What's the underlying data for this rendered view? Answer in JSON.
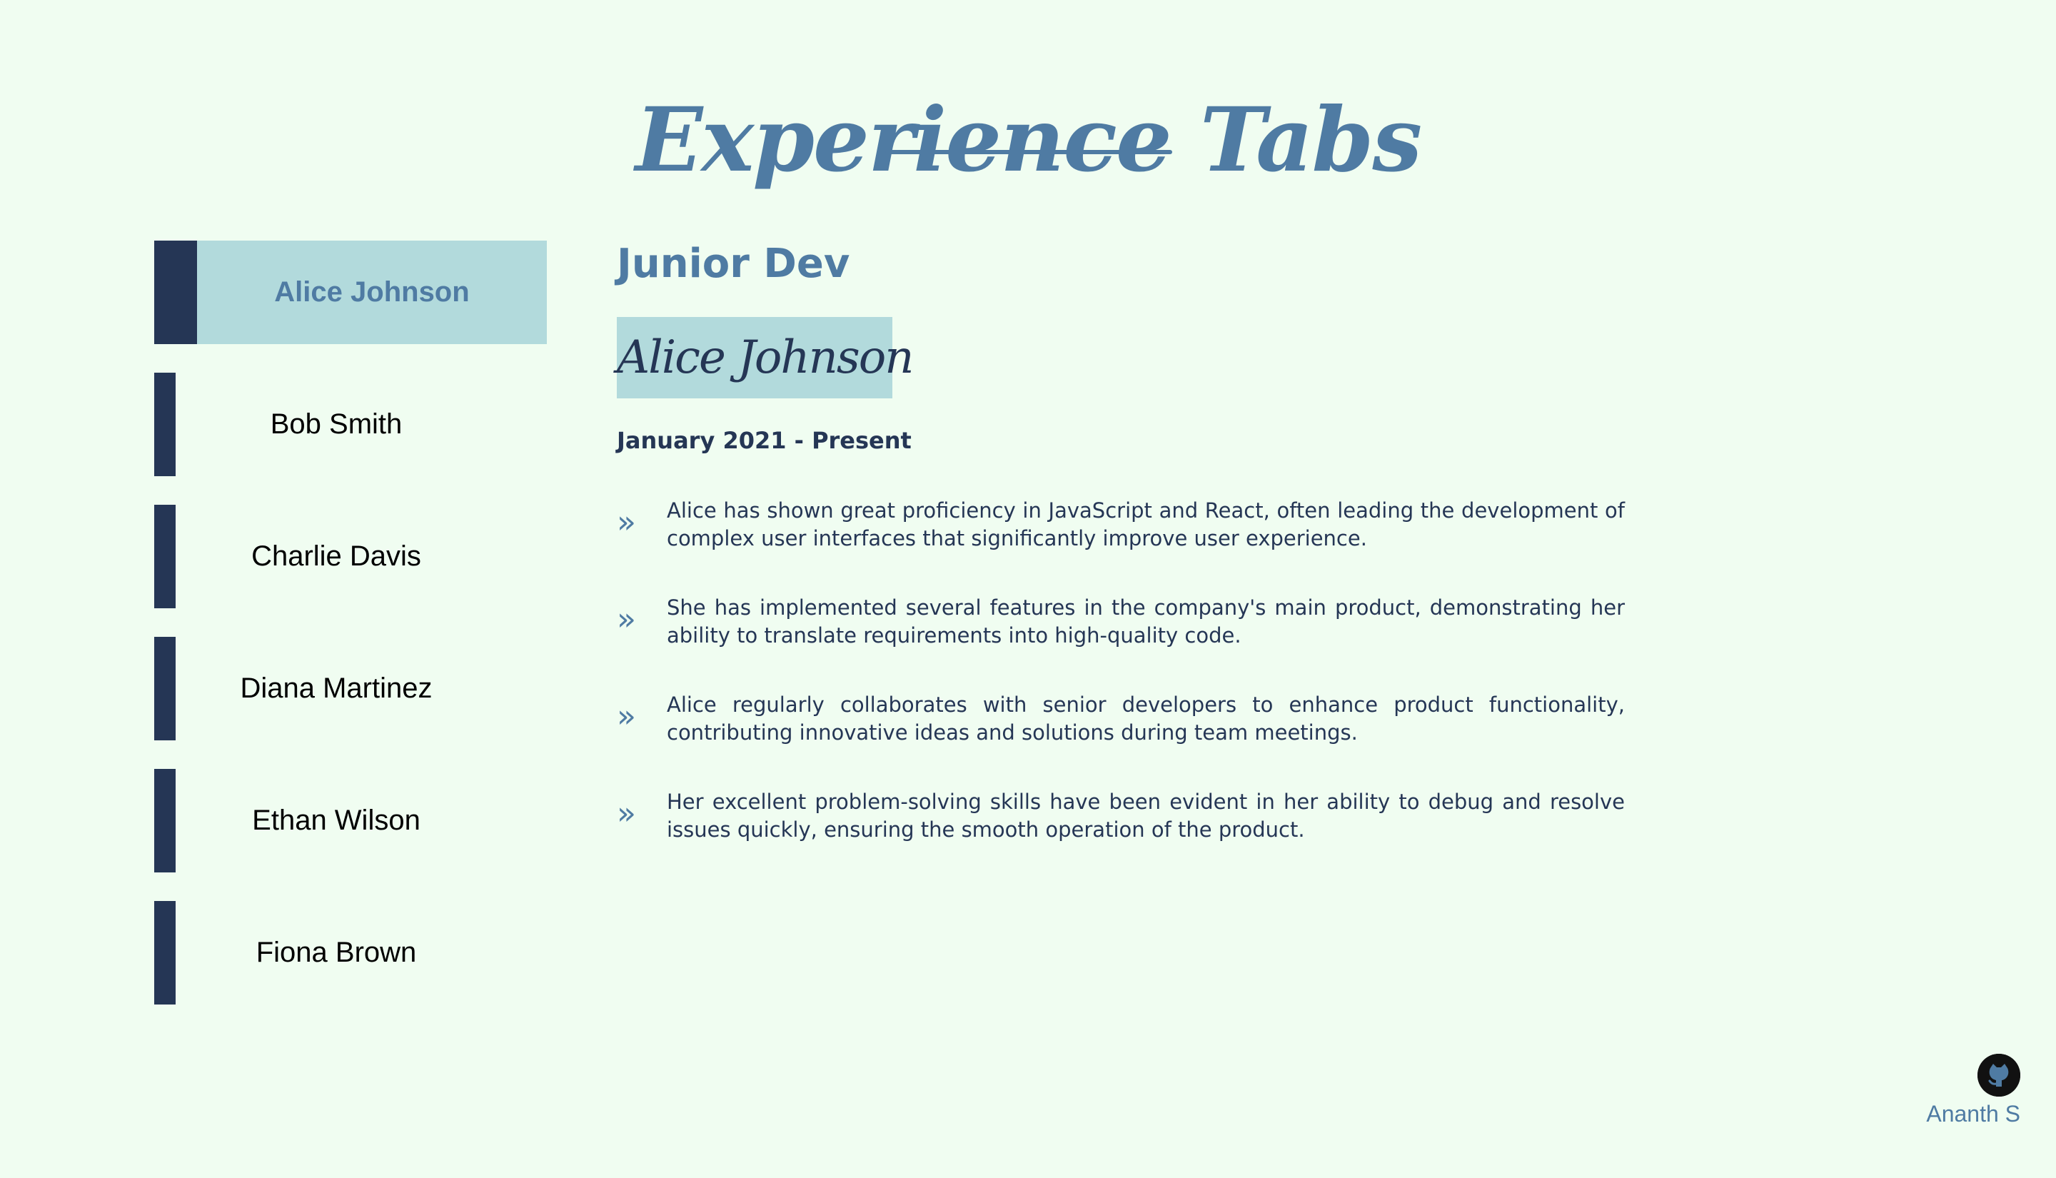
{
  "header": {
    "title": "Experience Tabs"
  },
  "tabs": [
    {
      "label": "Alice Johnson",
      "active": true
    },
    {
      "label": "Bob Smith",
      "active": false
    },
    {
      "label": "Charlie Davis",
      "active": false
    },
    {
      "label": "Diana Martinez",
      "active": false
    },
    {
      "label": "Ethan Wilson",
      "active": false
    },
    {
      "label": "Fiona Brown",
      "active": false
    }
  ],
  "detail": {
    "job_title": "Junior Dev",
    "name": "Alice Johnson",
    "period": "January 2021 - Present",
    "bullet_icon": "double-chevron-right-icon",
    "bullets": [
      "Alice has shown great proficiency in JavaScript and React, often leading the development of complex user interfaces that significantly improve user experience.",
      "She has implemented several features in the company's main product, demonstrating her ability to translate requirements into high-quality code.",
      "Alice regularly collaborates with senior developers to enhance product functionality, contributing innovative ideas and solutions during team meetings.",
      "Her excellent problem-solving skills have been evident in her ability to debug and resolve issues quickly, ensuring the smooth operation of the product."
    ]
  },
  "footer": {
    "icon": "github-icon",
    "author": "Ananth S"
  },
  "colors": {
    "background": "#f0fdf1",
    "accent": "#4f7ba3",
    "dark": "#253655",
    "highlight": "#b2dadc"
  }
}
